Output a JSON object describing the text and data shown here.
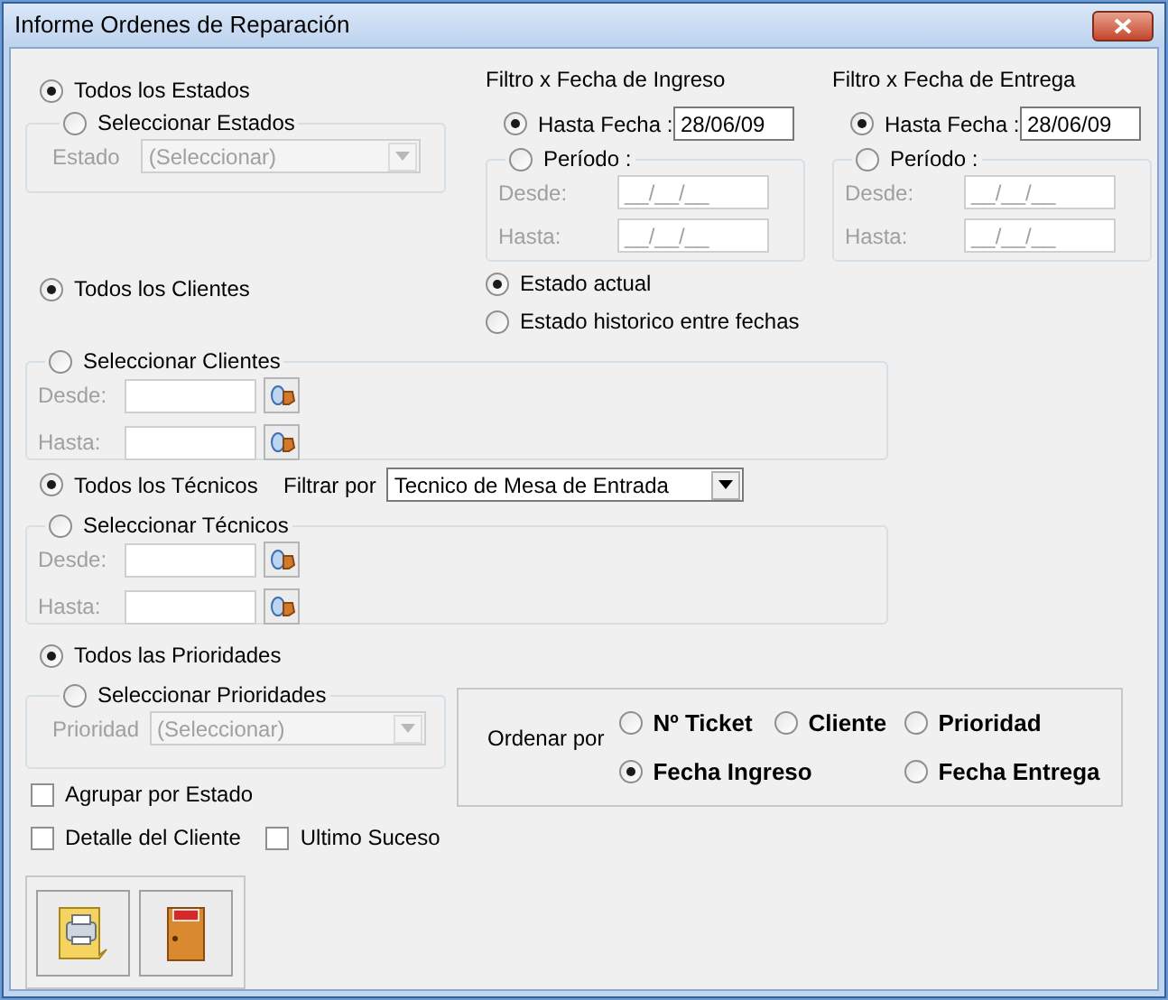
{
  "window": {
    "title": "Informe Ordenes de Reparación"
  },
  "estados": {
    "options": [
      {
        "label": "Todos los Estados",
        "selected": true
      },
      {
        "label": "Seleccionar Estados",
        "selected": false
      }
    ],
    "disabled": true,
    "field_label": "Estado",
    "field_value": "(Seleccionar)"
  },
  "fecha_filters": [
    {
      "title": "Filtro x Fecha de Ingreso",
      "options": [
        {
          "label": "Hasta Fecha :",
          "selected": true
        },
        {
          "label": "Período :",
          "selected": false
        }
      ],
      "hasta_fecha": "28/06/09",
      "disabled": true,
      "desde_label": "Desde:",
      "desde_value": "__/__/__",
      "hasta_label": "Hasta:",
      "hasta_value": "__/__/__"
    },
    {
      "title": "Filtro x Fecha de Entrega",
      "options": [
        {
          "label": "Hasta Fecha :",
          "selected": true
        },
        {
          "label": "Período :",
          "selected": false
        }
      ],
      "hasta_fecha": "28/06/09",
      "disabled": true,
      "desde_label": "Desde:",
      "desde_value": "__/__/__",
      "hasta_label": "Hasta:",
      "hasta_value": "__/__/__"
    }
  ],
  "estado_mode": [
    {
      "label": "Estado actual",
      "selected": true
    },
    {
      "label": "Estado historico entre fechas",
      "selected": false
    }
  ],
  "clientes": {
    "options": [
      {
        "label": "Todos los Clientes",
        "selected": true
      },
      {
        "label": "Seleccionar Clientes",
        "selected": false
      }
    ],
    "disabled": true,
    "desde_label": "Desde:",
    "hasta_label": "Hasta:"
  },
  "tecnicos": {
    "options": [
      {
        "label": "Todos los Técnicos",
        "selected": true
      },
      {
        "label": "Seleccionar Técnicos",
        "selected": false
      }
    ],
    "disabled": true,
    "filter_label": "Filtrar por",
    "filter_value": "Tecnico de Mesa de Entrada",
    "desde_label": "Desde:",
    "hasta_label": "Hasta:"
  },
  "prioridades": {
    "options": [
      {
        "label": "Todos las Prioridades",
        "selected": true
      },
      {
        "label": "Seleccionar Prioridades",
        "selected": false
      }
    ],
    "disabled": true,
    "field_label": "Prioridad",
    "field_value": "(Seleccionar)"
  },
  "order": {
    "label": "Ordenar por",
    "options": [
      {
        "label": "Nº Ticket",
        "selected": false
      },
      {
        "label": "Cliente",
        "selected": false
      },
      {
        "label": "Prioridad",
        "selected": false
      },
      {
        "label": "Fecha Ingreso",
        "selected": true
      },
      {
        "label": "Fecha Entrega",
        "selected": false
      }
    ]
  },
  "checkboxes": [
    {
      "label": "Agrupar por Estado",
      "checked": false
    },
    {
      "label": "Detalle del Cliente",
      "checked": false
    },
    {
      "label": "Ultimo Suceso",
      "checked": false
    }
  ]
}
